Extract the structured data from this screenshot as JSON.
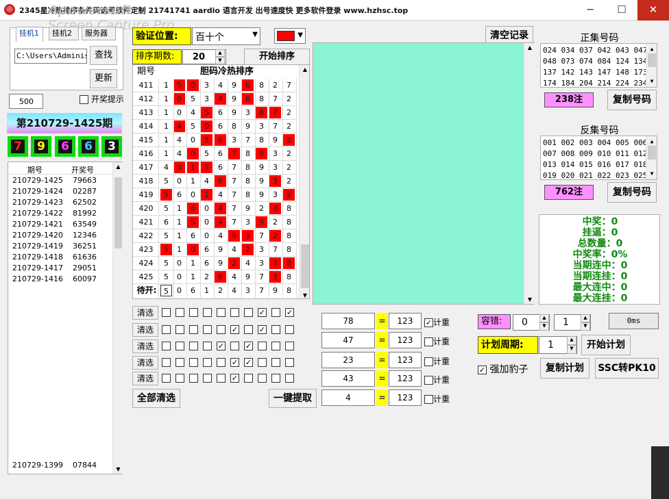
{
  "window": {
    "title": "2345星冷热排序条件码选号软件定制 21741741 aardio 语言开发 出号速度快 更多软件登录 www.hzhsc.top",
    "watermark_line1": "Apowersoft",
    "watermark_line2": "Screen Capture Pro",
    "minimize": "─",
    "maximize": "☐",
    "close": "✕",
    "app_icon": "ring-icon"
  },
  "left": {
    "tabs": [
      "挂机1",
      "挂机2",
      "服务器"
    ],
    "path_value": "C:\\Users\\Administ",
    "find_button": "查找",
    "update_button": "更新",
    "count_value": "500",
    "prize_hint_label": "开奖提示",
    "period_banner": "第210729-1425期",
    "digits": [
      {
        "value": "7",
        "color": "#ff2020"
      },
      {
        "value": "9",
        "color": "#ffff00"
      },
      {
        "value": "6",
        "color": "#ff40ff"
      },
      {
        "value": "6",
        "color": "#40c8ff"
      },
      {
        "value": "3",
        "color": "#ffffff"
      }
    ],
    "history_headers": [
      "期号",
      "开奖号"
    ],
    "history_rows": [
      [
        "210729-1425",
        "79663"
      ],
      [
        "210729-1424",
        "02287"
      ],
      [
        "210729-1423",
        "62502"
      ],
      [
        "210729-1422",
        "81992"
      ],
      [
        "210729-1421",
        "63549"
      ],
      [
        "210729-1420",
        "12346"
      ],
      [
        "210729-1419",
        "36251"
      ],
      [
        "210729-1418",
        "61636"
      ],
      [
        "210729-1417",
        "29051"
      ],
      [
        "210729-1416",
        "60097"
      ]
    ],
    "history_bottom_row": [
      "210729-1399",
      "07844"
    ]
  },
  "controls": {
    "verify_position_label": "验证位置:",
    "verify_position_value": "百十个",
    "color_swatch": "#ff0000",
    "sort_periods_label": "排序期数:",
    "sort_periods_value": "20",
    "start_sort_button": "开始排序",
    "clear_record_button": "清空记录"
  },
  "grid": {
    "header_period": "期号",
    "header_title": "胆码冷热排序",
    "pending_label": "待开:",
    "rows": [
      {
        "period": "411",
        "cells": [
          "1",
          "5",
          "0",
          "3",
          "4",
          "9",
          "6",
          "8",
          "2",
          "7"
        ],
        "red": [
          1,
          2,
          6
        ]
      },
      {
        "period": "412",
        "cells": [
          "1",
          "0",
          "5",
          "3",
          "4",
          "9",
          "6",
          "8",
          "7",
          "2"
        ],
        "red": [
          1,
          4,
          6
        ]
      },
      {
        "period": "413",
        "cells": [
          "1",
          "0",
          "4",
          "5",
          "6",
          "9",
          "3",
          "8",
          "7",
          "2"
        ],
        "red": [
          3,
          7,
          8
        ]
      },
      {
        "period": "414",
        "cells": [
          "1",
          "4",
          "5",
          "0",
          "6",
          "8",
          "9",
          "3",
          "7",
          "2"
        ],
        "red": [
          1,
          3
        ]
      },
      {
        "period": "415",
        "cells": [
          "1",
          "4",
          "0",
          "5",
          "6",
          "3",
          "7",
          "8",
          "9",
          "2"
        ],
        "red": [
          3,
          4,
          9
        ]
      },
      {
        "period": "416",
        "cells": [
          "1",
          "4",
          "0",
          "5",
          "6",
          "7",
          "8",
          "9",
          "3",
          "2"
        ],
        "red": [
          2,
          5,
          7
        ]
      },
      {
        "period": "417",
        "cells": [
          "4",
          "0",
          "1",
          "5",
          "6",
          "7",
          "8",
          "9",
          "3",
          "2"
        ],
        "red": [
          1,
          2,
          3
        ]
      },
      {
        "period": "418",
        "cells": [
          "5",
          "0",
          "1",
          "4",
          "6",
          "7",
          "8",
          "9",
          "3",
          "2"
        ],
        "red": [
          4,
          8
        ]
      },
      {
        "period": "419",
        "cells": [
          "5",
          "6",
          "0",
          "1",
          "4",
          "7",
          "8",
          "9",
          "3",
          "2"
        ],
        "red": [
          0,
          3,
          9
        ]
      },
      {
        "period": "420",
        "cells": [
          "5",
          "1",
          "6",
          "0",
          "4",
          "7",
          "9",
          "2",
          "3",
          "8"
        ],
        "red": [
          2,
          4,
          8
        ]
      },
      {
        "period": "421",
        "cells": [
          "6",
          "1",
          "5",
          "0",
          "4",
          "7",
          "3",
          "9",
          "2",
          "8"
        ],
        "red": [
          2,
          4,
          7
        ]
      },
      {
        "period": "422",
        "cells": [
          "5",
          "1",
          "6",
          "0",
          "4",
          "9",
          "3",
          "7",
          "2",
          "8"
        ],
        "red": [
          5,
          6,
          8
        ]
      },
      {
        "period": "423",
        "cells": [
          "5",
          "1",
          "0",
          "6",
          "9",
          "4",
          "2",
          "3",
          "7",
          "8"
        ],
        "red": [
          0,
          2,
          6
        ]
      },
      {
        "period": "424",
        "cells": [
          "5",
          "0",
          "1",
          "6",
          "9",
          "2",
          "4",
          "3",
          "7",
          "8"
        ],
        "red": [
          5,
          8,
          9
        ]
      },
      {
        "period": "425",
        "cells": [
          "5",
          "0",
          "1",
          "2",
          "6",
          "4",
          "9",
          "7",
          "3",
          "8"
        ],
        "red": [
          4,
          8
        ]
      }
    ],
    "pending_cells": [
      "5",
      "0",
      "6",
      "1",
      "2",
      "4",
      "3",
      "7",
      "9",
      "8"
    ]
  },
  "selection": {
    "clear_button": "清选",
    "rows": [
      [
        false,
        false,
        false,
        false,
        false,
        false,
        false,
        true,
        false,
        true
      ],
      [
        false,
        false,
        false,
        false,
        false,
        true,
        false,
        true,
        false,
        false
      ],
      [
        false,
        false,
        false,
        false,
        true,
        false,
        true,
        false,
        false,
        false
      ],
      [
        false,
        false,
        false,
        false,
        false,
        true,
        true,
        false,
        false,
        false
      ],
      [
        false,
        false,
        false,
        false,
        false,
        true,
        false,
        false,
        false,
        false
      ]
    ],
    "clear_all_button": "全部清选",
    "one_click_extract_button": "一键提取"
  },
  "weights": {
    "rows": [
      {
        "left": "78",
        "eq": "=",
        "right": "123",
        "label": "计重",
        "checked": true
      },
      {
        "left": "47",
        "eq": "=",
        "right": "123",
        "label": "计重",
        "checked": false
      },
      {
        "left": "23",
        "eq": "=",
        "right": "123",
        "label": "计重",
        "checked": false
      },
      {
        "left": "43",
        "eq": "=",
        "right": "123",
        "label": "计重",
        "checked": false
      },
      {
        "left": "4",
        "eq": "=",
        "right": "123",
        "label": "计重",
        "checked": false
      }
    ]
  },
  "plan": {
    "tolerance_label": "容错:",
    "tolerance_from": "0",
    "tolerance_to": "1",
    "time_display": "0ms",
    "cycle_label": "计划周期:",
    "cycle_value": "1",
    "start_plan_button": "开始计划",
    "force_leopard_label": "强加豹子",
    "force_leopard_checked": true,
    "copy_plan_button": "复制计划",
    "ssc_to_pk10_button": "SSC转PK10"
  },
  "positive": {
    "title": "正集号码",
    "lines": [
      "024 034 037 042 043 047",
      "048 073 074 084 124 134",
      "137 142 143 147 148 173",
      "174 184 204 214 224 234"
    ],
    "count": "238注",
    "copy_button": "复制号码"
  },
  "negative": {
    "title": "反集号码",
    "lines": [
      "001 002 003 004 005 006",
      "007 008 009 010 011 012",
      "013 014 015 016 017 018",
      "019 020 021 022 023 025"
    ],
    "count": "762注",
    "copy_button": "复制号码"
  },
  "stats": {
    "lines": [
      "中奖：0",
      "挂逼：0",
      "总数量：0",
      "中奖率：0%",
      "当期连中：0",
      "当期连挂：0",
      "最大连中：0",
      "最大连挂：0"
    ]
  }
}
